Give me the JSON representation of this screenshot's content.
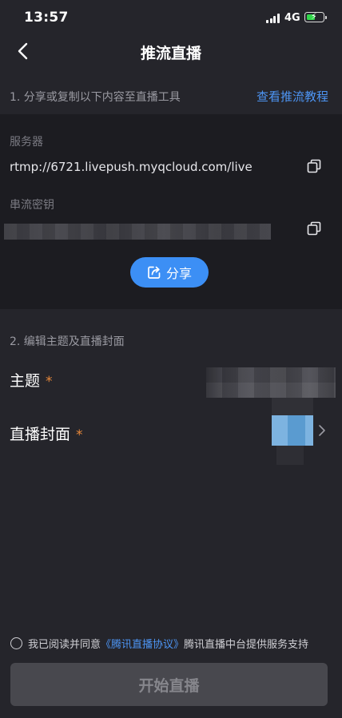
{
  "status_bar": {
    "time": "13:57",
    "network": "4G",
    "battery_level": 0.55,
    "battery_charging": true
  },
  "nav": {
    "title": "推流直播",
    "back_icon": "chevron-left-icon"
  },
  "section1": {
    "label": "1. 分享或复制以下内容至直播工具",
    "tutorial_link": "查看推流教程"
  },
  "server": {
    "label": "服务器",
    "value": "rtmp://6721.livepush.myqcloud.com/live",
    "copy_icon": "copy-icon"
  },
  "stream_key": {
    "label": "串流密钥",
    "copy_icon": "copy-icon"
  },
  "share_button": {
    "label": "分享",
    "icon": "share-icon"
  },
  "section2": {
    "label": "2. 编辑主题及直播封面"
  },
  "topic": {
    "label": "主题",
    "required_mark": "*"
  },
  "cover": {
    "label": "直播封面",
    "required_mark": "*",
    "chevron_icon": "chevron-right-icon"
  },
  "agreement": {
    "prefix": "我已阅读并同意",
    "link": "《腾讯直播协议》",
    "suffix": "腾讯直播中台提供服务支持",
    "checked": false
  },
  "start_button": {
    "label": "开始直播",
    "enabled": false
  },
  "colors": {
    "background": "#25252b",
    "card": "#1c1c21",
    "accent": "#3c8ff5",
    "link": "#4d95f4",
    "required": "#e8883a",
    "disabled_button": "#48484e"
  }
}
